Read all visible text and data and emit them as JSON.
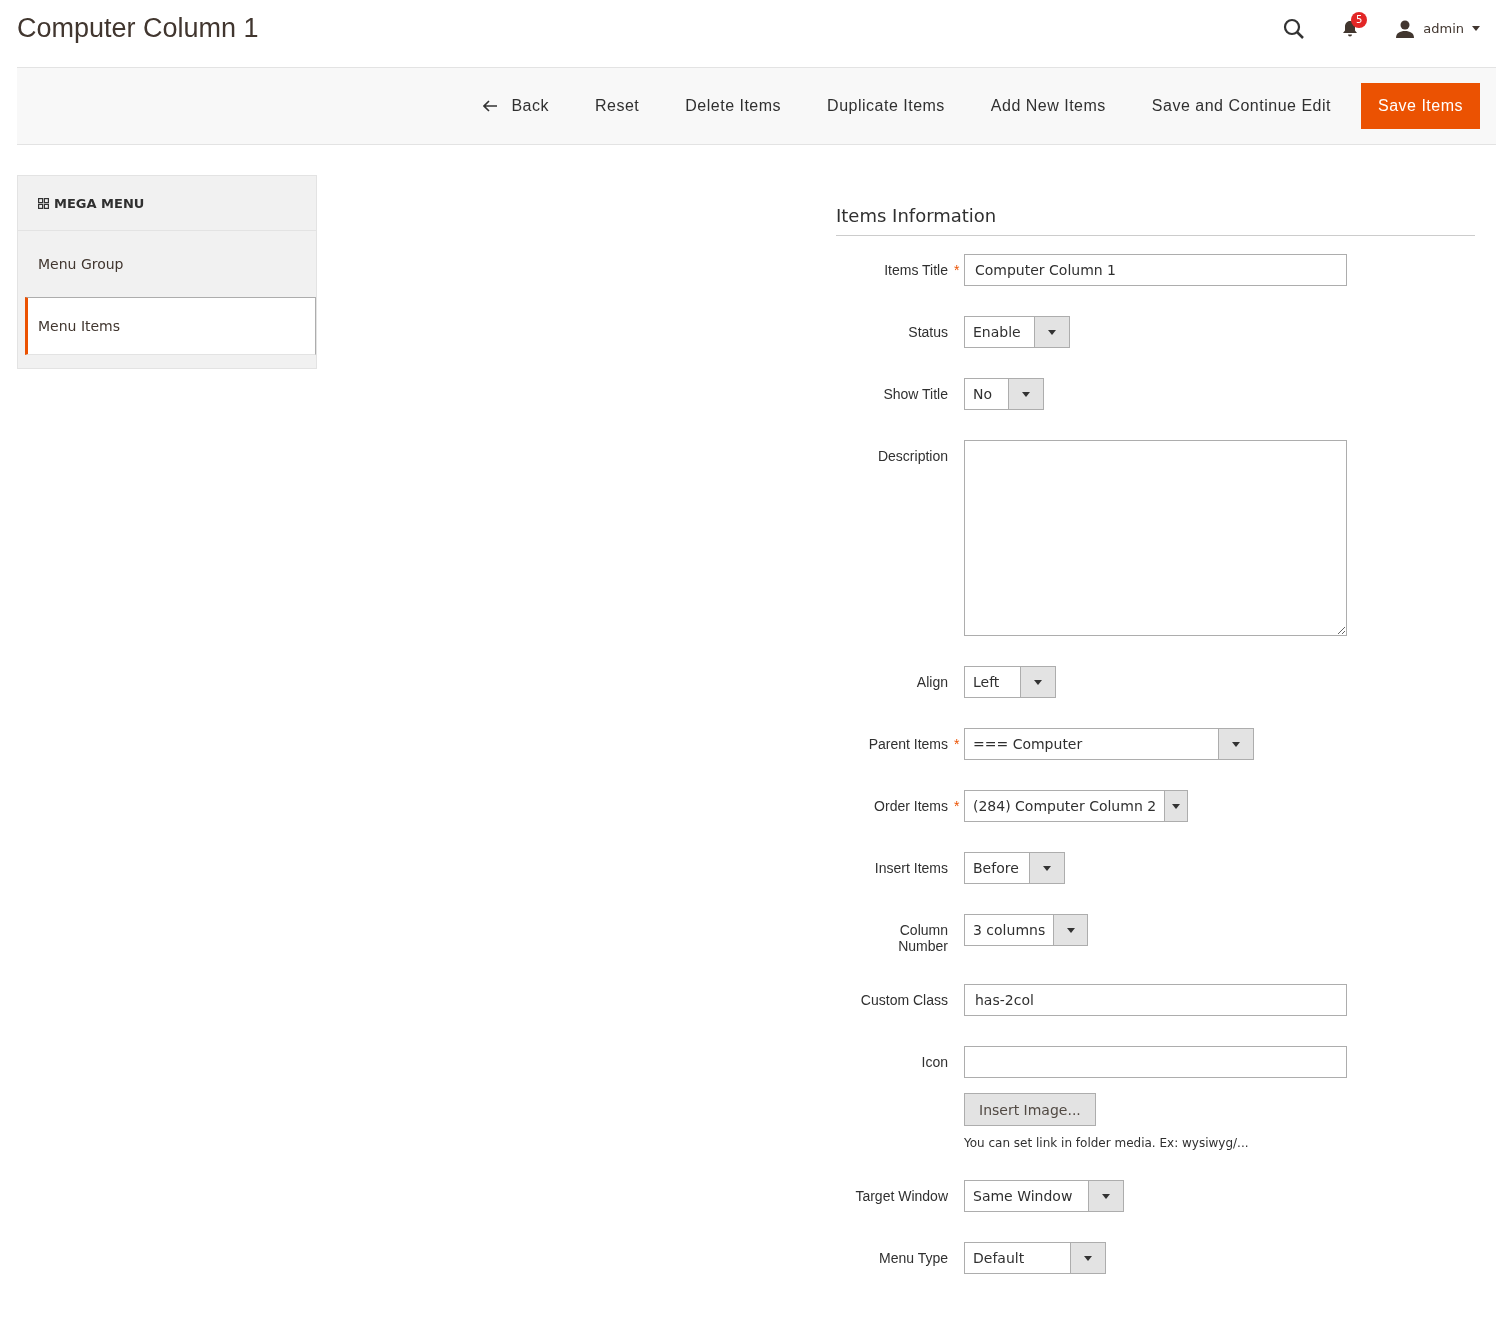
{
  "page_title": "Computer Column 1",
  "header": {
    "notification_count": "5",
    "user": "admin"
  },
  "toolbar": {
    "buttons": [
      {
        "label": "Back",
        "kind": "back"
      },
      {
        "label": "Reset",
        "kind": "plain"
      },
      {
        "label": "Delete Items",
        "kind": "plain"
      },
      {
        "label": "Duplicate Items",
        "kind": "plain"
      },
      {
        "label": "Add New Items",
        "kind": "plain"
      },
      {
        "label": "Save and Continue Edit",
        "kind": "plain"
      },
      {
        "label": "Save Items",
        "kind": "primary"
      }
    ]
  },
  "sidebar": {
    "title": "MEGA MENU",
    "items": [
      {
        "label": "Menu Group",
        "selected": false
      },
      {
        "label": "Menu Items",
        "selected": true
      }
    ]
  },
  "form": {
    "title": "Items Information",
    "fields": [
      {
        "label": "Items Title",
        "required_mark": "*",
        "kind": "text",
        "value": "Computer Column 1"
      },
      {
        "label": "Status",
        "kind": "select",
        "value": "Enable"
      },
      {
        "label": "Show Title",
        "kind": "select",
        "value": "No"
      },
      {
        "label": "Description",
        "kind": "textarea"
      },
      {
        "label": "Align",
        "kind": "select",
        "value": "Left"
      },
      {
        "label": "Parent Items",
        "required_mark": "*",
        "kind": "select",
        "value": "=== Computer"
      },
      {
        "label": "Order Items",
        "required_mark": "*",
        "kind": "select",
        "value": "(284) Computer Column 2"
      },
      {
        "label": "Insert Items",
        "kind": "select",
        "value": "Before"
      },
      {
        "label": "Column Number",
        "kind": "select",
        "value": "3 columns"
      },
      {
        "label": "Custom Class",
        "kind": "text",
        "value": "has-2col"
      },
      {
        "label": "Icon",
        "kind": "image",
        "button": "Insert Image...",
        "note": "You can set link in folder media. Ex: wysiwyg/..."
      },
      {
        "label": "Target Window",
        "kind": "select",
        "value": "Same Window"
      },
      {
        "label": "Menu Type",
        "kind": "select",
        "value": "Default"
      }
    ]
  }
}
